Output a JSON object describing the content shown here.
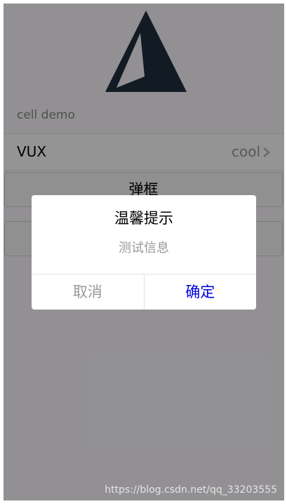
{
  "group": {
    "title": "cell demo"
  },
  "cell": {
    "title": "VUX",
    "value": "cool"
  },
  "buttons": {
    "alert_label": "弹框",
    "second_label": ""
  },
  "dialog": {
    "title": "温馨提示",
    "content": "测试信息",
    "cancel_label": "取消",
    "confirm_label": "确定"
  },
  "watermark": "https://blog.csdn.net/qq_33203555",
  "colors": {
    "logo": "#1f2d3d",
    "confirm": "#0000dd",
    "muted": "#999999",
    "mask": "rgba(0,0,0,0.42)"
  },
  "icons": {
    "logo": "vux-triangle-logo",
    "chevron": "chevron-right-icon"
  }
}
